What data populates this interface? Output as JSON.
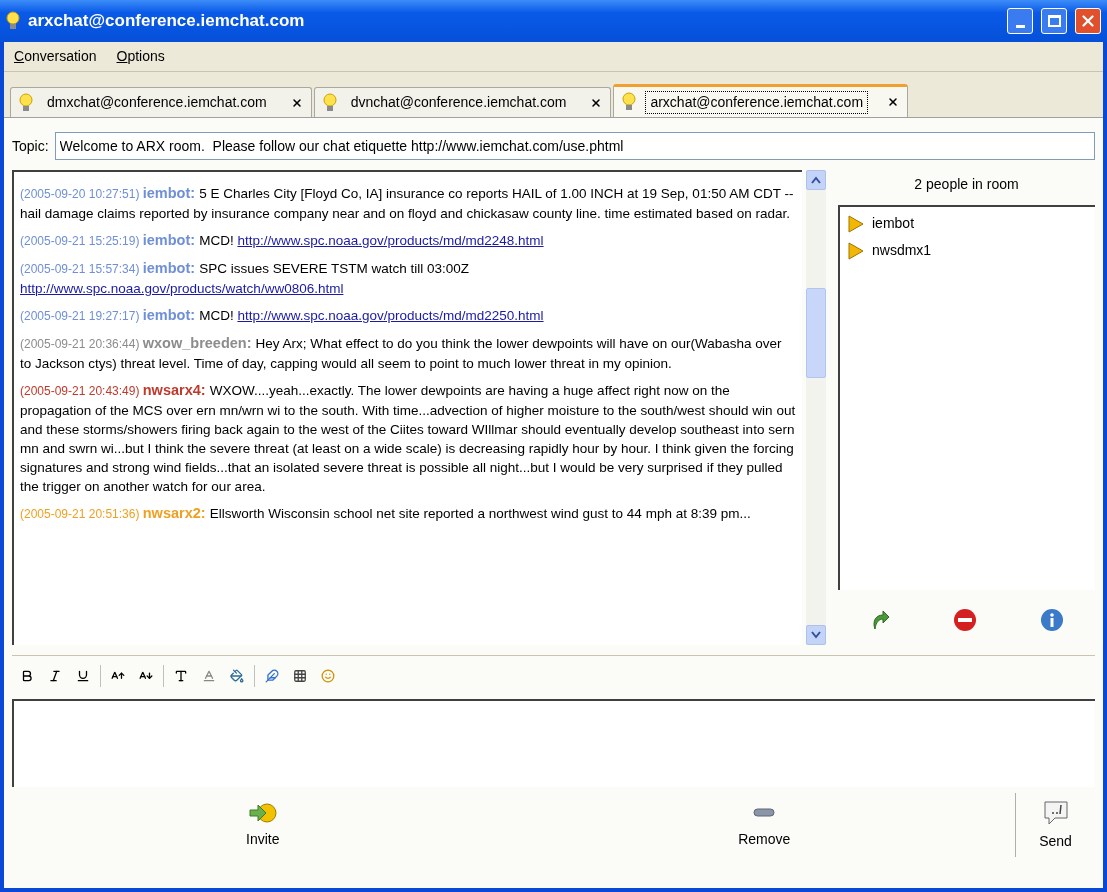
{
  "window": {
    "title": "arxchat@conference.iemchat.com"
  },
  "menu": [
    {
      "label": "Conversation"
    },
    {
      "label": "Options"
    }
  ],
  "tabs": [
    {
      "label": "dmxchat@conference.iemchat.com",
      "selected": false
    },
    {
      "label": "dvnchat@conference.iemchat.com",
      "selected": false
    },
    {
      "label": "arxchat@conference.iemchat.com",
      "selected": true
    }
  ],
  "topic": {
    "label": "Topic:",
    "value": "Welcome to ARX room.  Please follow our chat etiquette http://www.iemchat.com/use.phtml"
  },
  "messages": [
    {
      "time": "(2005-09-20 10:27:51)",
      "nick": "iembot:",
      "color": "#6f8fd6",
      "parts": [
        {
          "kind": "text",
          "text": "5 E Charles City [Floyd Co, IA] insurance co reports HAIL of 1.00 INCH at 19 Sep, 01:50 AM CDT -- hail damage claims reported by insurance company near and on floyd and chickasaw county line. time estimated based on radar."
        }
      ]
    },
    {
      "time": "(2005-09-21 15:25:19)",
      "nick": "iembot:",
      "color": "#6f8fd6",
      "parts": [
        {
          "kind": "text",
          "text": "MCD!"
        },
        {
          "kind": "link",
          "text": "http://www.spc.noaa.gov/products/md/md2248.html"
        }
      ]
    },
    {
      "time": "(2005-09-21 15:57:34)",
      "nick": "iembot:",
      "color": "#6f8fd6",
      "parts": [
        {
          "kind": "text",
          "text": "SPC issues SEVERE TSTM watch till 03:00Z"
        },
        {
          "kind": "link",
          "text": "http://www.spc.noaa.gov/products/watch/ww0806.html"
        }
      ]
    },
    {
      "time": "(2005-09-21 19:27:17)",
      "nick": "iembot:",
      "color": "#6f8fd6",
      "parts": [
        {
          "kind": "text",
          "text": "MCD!"
        },
        {
          "kind": "link",
          "text": "http://www.spc.noaa.gov/products/md/md2250.html"
        }
      ]
    },
    {
      "time": "(2005-09-21 20:36:44)",
      "nick": "wxow_breeden:",
      "color": "#8c8c8c",
      "parts": [
        {
          "kind": "text",
          "text": "Hey Arx; What effect to do you think the lower dewpoints will have on our(Wabasha over to Jackson ctys) threat level. Time of day, capping would all seem to point to much lower threat in my opinion."
        }
      ]
    },
    {
      "time": "(2005-09-21 20:43:49)",
      "nick": "nwsarx4:",
      "color": "#c0392b",
      "parts": [
        {
          "kind": "text",
          "text": "WXOW....yeah...exactly.  The lower dewpoints are having a huge affect right now on the propagation of the MCS over ern mn/wrn wi to the south.  With time...advection of higher moisture to the south/west should win out and these storms/showers firing back again to the west of the Ciites toward WIllmar should eventually develop southeast into sern mn and swrn wi...but I think the severe threat (at least on a wide scale) is decreasing rapidly hour by hour. I think given the forcing signatures and strong wind fields...that an isolated severe threat is possible all night...but I would be very surprised if they pulled the trigger on another watch for our area."
        }
      ]
    },
    {
      "time": "(2005-09-21 20:51:36)",
      "nick": "nwsarx2:",
      "color": "#f0a020",
      "parts": [
        {
          "kind": "text",
          "text": "Ellsworth Wisconsin school net site reported a northwest wind gust to 44 mph at 8:39 pm..."
        }
      ]
    }
  ],
  "people": {
    "count_label": "2 people in room",
    "items": [
      {
        "name": "iembot"
      },
      {
        "name": "nwsdmx1"
      }
    ]
  },
  "actions": [
    {
      "label": "Invite",
      "kind": "invite"
    },
    {
      "label": "Remove",
      "kind": "remove"
    },
    {
      "label": "Send",
      "kind": "send"
    }
  ]
}
